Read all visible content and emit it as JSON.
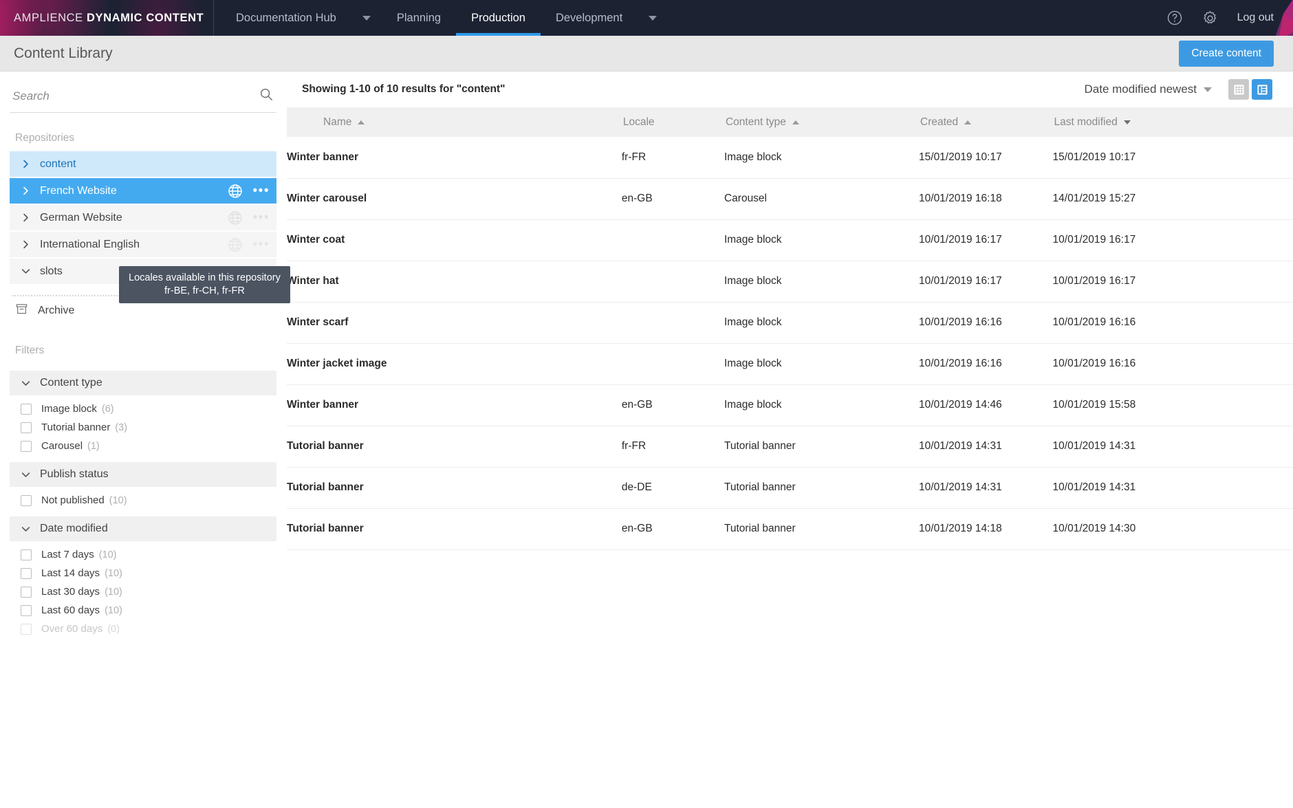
{
  "topnav": {
    "brand_light": "AMPLIENCE",
    "brand_bold": "DYNAMIC CONTENT",
    "items": [
      {
        "label": "Documentation Hub",
        "active": false,
        "has_caret": true
      },
      {
        "label": "Planning",
        "active": false,
        "has_caret": false
      },
      {
        "label": "Production",
        "active": true,
        "has_caret": false
      },
      {
        "label": "Development",
        "active": false,
        "has_caret": true
      }
    ],
    "help_icon": "help-circle-icon",
    "settings_icon": "gear-icon",
    "logout_label": "Log out"
  },
  "titlebar": {
    "title": "Content Library",
    "create_label": "Create content"
  },
  "sidebar": {
    "search_placeholder": "Search",
    "search_value": "",
    "search_icon": "search-icon",
    "repositories_label": "Repositories",
    "repositories": [
      {
        "name": "content",
        "state": "light-selected",
        "expanded": false,
        "has_globe": false,
        "has_dots": false
      },
      {
        "name": "French Website",
        "state": "selected",
        "expanded": false,
        "has_globe": true,
        "has_dots": true
      },
      {
        "name": "German Website",
        "state": "normal",
        "expanded": false,
        "has_globe": true,
        "has_dots": true
      },
      {
        "name": "International English",
        "state": "normal",
        "expanded": false,
        "has_globe": true,
        "has_dots": true
      },
      {
        "name": "slots",
        "state": "normal",
        "expanded": true,
        "has_globe": false,
        "has_dots": true
      }
    ],
    "archive_label": "Archive",
    "archive_icon": "archive-box-icon",
    "filters_label": "Filters",
    "filter_groups": [
      {
        "title": "Content type",
        "expanded": true,
        "options": [
          {
            "label": "Image block",
            "count": "(6)",
            "checked": false,
            "disabled": false
          },
          {
            "label": "Tutorial banner",
            "count": "(3)",
            "checked": false,
            "disabled": false
          },
          {
            "label": "Carousel",
            "count": "(1)",
            "checked": false,
            "disabled": false
          }
        ]
      },
      {
        "title": "Publish status",
        "expanded": true,
        "options": [
          {
            "label": "Not published",
            "count": "(10)",
            "checked": false,
            "disabled": false
          }
        ]
      },
      {
        "title": "Date modified",
        "expanded": true,
        "options": [
          {
            "label": "Last 7 days",
            "count": "(10)",
            "checked": false,
            "disabled": false
          },
          {
            "label": "Last 14 days",
            "count": "(10)",
            "checked": false,
            "disabled": false
          },
          {
            "label": "Last 30 days",
            "count": "(10)",
            "checked": false,
            "disabled": false
          },
          {
            "label": "Last 60 days",
            "count": "(10)",
            "checked": false,
            "disabled": false
          },
          {
            "label": "Over 60 days",
            "count": "(0)",
            "checked": false,
            "disabled": true
          }
        ]
      }
    ],
    "tooltip": {
      "line1": "Locales available in this repository",
      "line2": "fr-BE, fr-CH, fr-FR"
    }
  },
  "main": {
    "results_text": "Showing 1-10 of 10 results for \"content\"",
    "sort_label": "Date modified newest",
    "view_grid_icon": "grid-view-icon",
    "view_list_icon": "list-view-icon",
    "active_view": "list",
    "columns": [
      {
        "label": "Name",
        "sort": "asc"
      },
      {
        "label": "Locale",
        "sort": "none"
      },
      {
        "label": "Content type",
        "sort": "asc"
      },
      {
        "label": "Created",
        "sort": "asc"
      },
      {
        "label": "Last modified",
        "sort": "desc"
      }
    ],
    "rows": [
      {
        "name": "Winter banner",
        "locale": "fr-FR",
        "content_type": "Image block",
        "created": "15/01/2019 10:17",
        "modified": "15/01/2019 10:17"
      },
      {
        "name": "Winter carousel",
        "locale": "en-GB",
        "content_type": "Carousel",
        "created": "10/01/2019 16:18",
        "modified": "14/01/2019 15:27"
      },
      {
        "name": "Winter coat",
        "locale": "",
        "content_type": "Image block",
        "created": "10/01/2019 16:17",
        "modified": "10/01/2019 16:17"
      },
      {
        "name": "Winter hat",
        "locale": "",
        "content_type": "Image block",
        "created": "10/01/2019 16:17",
        "modified": "10/01/2019 16:17"
      },
      {
        "name": "Winter scarf",
        "locale": "",
        "content_type": "Image block",
        "created": "10/01/2019 16:16",
        "modified": "10/01/2019 16:16"
      },
      {
        "name": "Winter jacket image",
        "locale": "",
        "content_type": "Image block",
        "created": "10/01/2019 16:16",
        "modified": "10/01/2019 16:16"
      },
      {
        "name": "Winter banner",
        "locale": "en-GB",
        "content_type": "Image block",
        "created": "10/01/2019 14:46",
        "modified": "10/01/2019 15:58"
      },
      {
        "name": "Tutorial banner",
        "locale": "fr-FR",
        "content_type": "Tutorial banner",
        "created": "10/01/2019 14:31",
        "modified": "10/01/2019 14:31"
      },
      {
        "name": "Tutorial banner",
        "locale": "de-DE",
        "content_type": "Tutorial banner",
        "created": "10/01/2019 14:31",
        "modified": "10/01/2019 14:31"
      },
      {
        "name": "Tutorial banner",
        "locale": "en-GB",
        "content_type": "Tutorial banner",
        "created": "10/01/2019 14:18",
        "modified": "10/01/2019 14:30"
      }
    ]
  },
  "colors": {
    "accent": "#3d9ae2",
    "selected_row": "#44aaf0",
    "light_selected_row": "#cfe8fa",
    "nav_bg": "#1d2233",
    "tooltip_bg": "#4c5462"
  }
}
